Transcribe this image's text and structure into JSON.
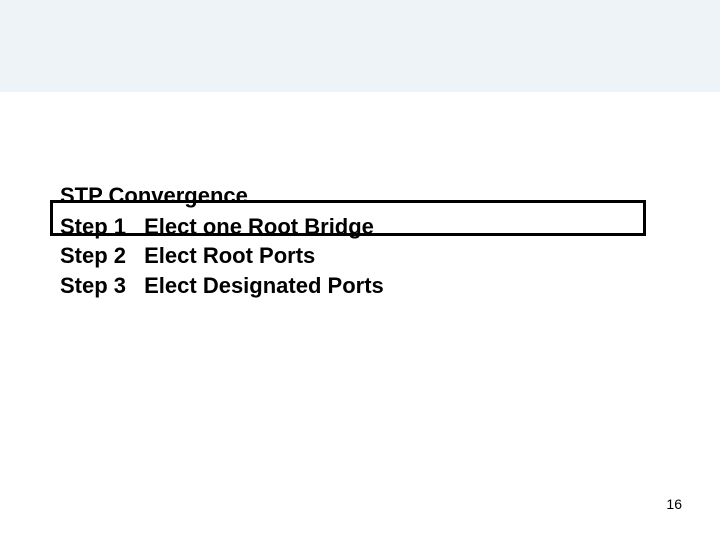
{
  "heading": "STP Convergence",
  "steps": [
    {
      "label": "Step 1",
      "text": "Elect one Root Bridge"
    },
    {
      "label": "Step 2",
      "text": "Elect Root Ports"
    },
    {
      "label": "Step 3",
      "text": "Elect Designated Ports"
    }
  ],
  "page_number": "16"
}
